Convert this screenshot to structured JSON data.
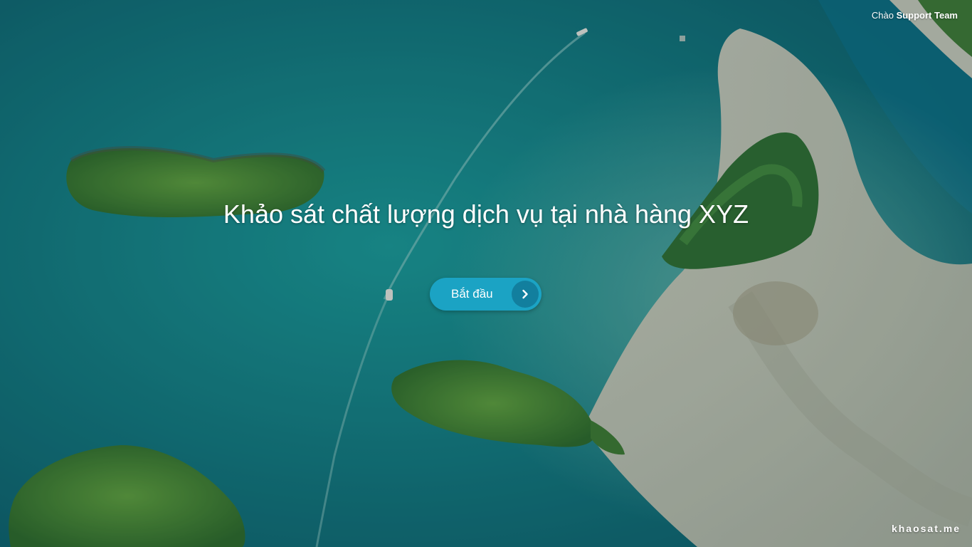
{
  "header": {
    "greeting_prefix": "Chào",
    "user_name": "Support Team"
  },
  "survey": {
    "title": "Khảo sát chất lượng dịch vụ tại nhà hàng XYZ",
    "start_label": "Bắt đầu",
    "start_icon": "chevron-right-icon"
  },
  "footer": {
    "brand": "khaosat.me"
  },
  "colors": {
    "button": "#1ba3c4",
    "button_icon_bg": "#127f9e",
    "water": "#0f6f78",
    "sand": "#cfc9b8",
    "forest": "#3c8a35"
  }
}
